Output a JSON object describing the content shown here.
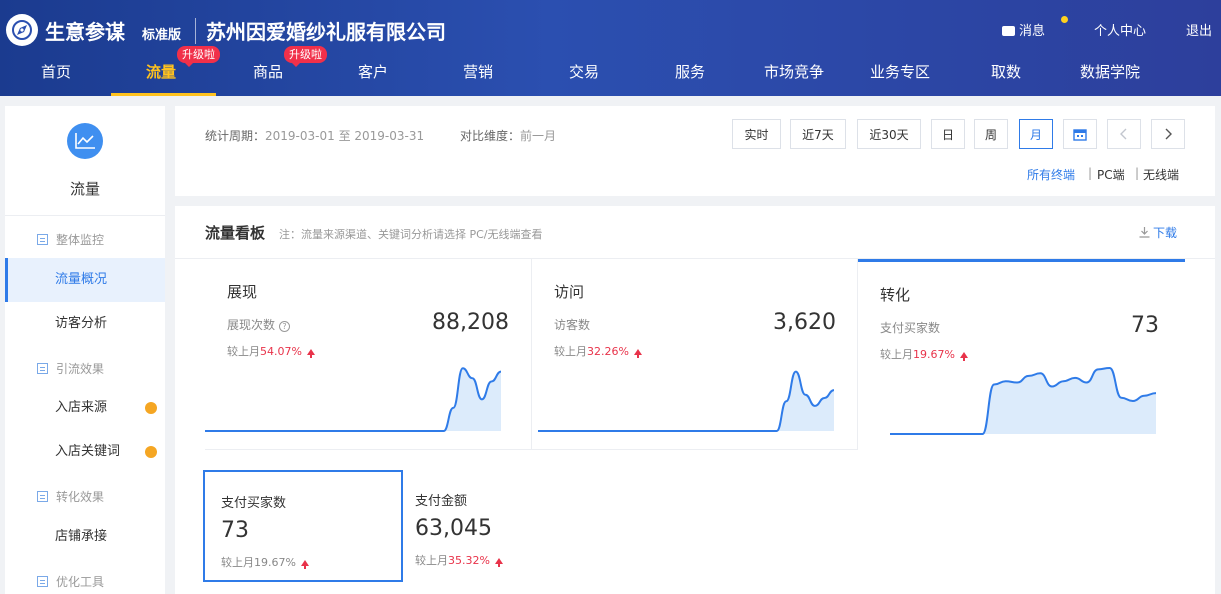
{
  "header": {
    "app_name": "生意参谋",
    "edition": "标准版",
    "company": "苏州因爱婚纱礼服有限公司",
    "links": {
      "messages": "消息",
      "personal_center": "个人中心",
      "logout": "退出"
    },
    "nav": [
      {
        "label": "首页"
      },
      {
        "label": "流量",
        "badge": "升级啦",
        "active": true
      },
      {
        "label": "商品",
        "badge": "升级啦"
      },
      {
        "label": "客户"
      },
      {
        "label": "营销"
      },
      {
        "label": "交易"
      },
      {
        "label": "服务"
      },
      {
        "label": "市场竞争"
      },
      {
        "label": "业务专区"
      },
      {
        "label": "取数"
      },
      {
        "label": "数据学院"
      }
    ],
    "colors": {
      "accent": "#ffc21e",
      "badge": "#f1304a"
    }
  },
  "sidebar": {
    "title": "流量",
    "icon": "line-chart-icon",
    "groups": [
      {
        "label": "整体监控",
        "items": [
          {
            "label": "流量概况",
            "active": true
          },
          {
            "label": "访客分析"
          }
        ]
      },
      {
        "label": "引流效果",
        "items": [
          {
            "label": "入店来源",
            "dot": true
          },
          {
            "label": "入店关键词",
            "dot": true
          }
        ]
      },
      {
        "label": "转化效果",
        "items": [
          {
            "label": "店铺承接"
          }
        ]
      },
      {
        "label": "优化工具",
        "items": []
      }
    ]
  },
  "period": {
    "stat_label": "统计周期：",
    "stat_value": "2019-03-01 至 2019-03-31",
    "compare_label": "对比维度：",
    "compare_value": "前一月",
    "buttons": [
      "实时",
      "近7天",
      "近30天",
      "日",
      "周",
      "月"
    ],
    "selected": "月",
    "terminals": {
      "all": "所有终端",
      "pc": "PC端",
      "mobile": "无线端",
      "sep": "|"
    }
  },
  "board": {
    "title": "流量看板",
    "note": "注：流量来源渠道、关键词分析请选择 PC/无线端查看",
    "download": "下载",
    "cards": [
      {
        "title": "展现",
        "metric_label": "展现次数",
        "value": "88,208",
        "compare_prefix": "较上月",
        "compare_value": "54.07%",
        "trend": [
          0,
          0,
          0,
          0,
          0,
          0,
          0,
          0,
          0,
          0,
          0,
          0,
          0,
          0,
          0,
          0,
          0,
          0,
          0,
          0,
          0,
          0,
          0,
          0,
          0,
          0,
          0.35,
          0.95,
          0.8,
          0.48,
          0.75,
          0.9
        ]
      },
      {
        "title": "访问",
        "metric_label": "访客数",
        "value": "3,620",
        "compare_prefix": "较上月",
        "compare_value": "32.26%",
        "trend": [
          0,
          0,
          0,
          0,
          0,
          0,
          0,
          0,
          0,
          0,
          0,
          0,
          0,
          0,
          0,
          0,
          0,
          0,
          0,
          0,
          0,
          0,
          0,
          0,
          0,
          0,
          0.45,
          0.9,
          0.55,
          0.38,
          0.5,
          0.62
        ]
      },
      {
        "title": "转化",
        "metric_label": "支付买家数",
        "value": "73",
        "compare_prefix": "较上月",
        "compare_value": "19.67%",
        "selected": true,
        "trend": [
          0,
          0,
          0,
          0,
          0,
          0,
          0,
          0,
          0,
          0.75,
          0.8,
          0.78,
          0.88,
          0.92,
          0.72,
          0.8,
          0.85,
          0.78,
          0.98,
          1.0,
          0.55,
          0.5,
          0.58,
          0.62
        ]
      }
    ],
    "minis": [
      {
        "label": "支付买家数",
        "value": "73",
        "compare_prefix": "较上月",
        "compare_value": "19.67%",
        "selected": true
      },
      {
        "label": "支付金额",
        "value": "63,045",
        "compare_prefix": "较上月",
        "compare_value": "35.32%"
      }
    ]
  },
  "colors": {
    "primary": "#2f7be8",
    "increase": "#e8334a",
    "spark_fill": "#dcebfb"
  }
}
